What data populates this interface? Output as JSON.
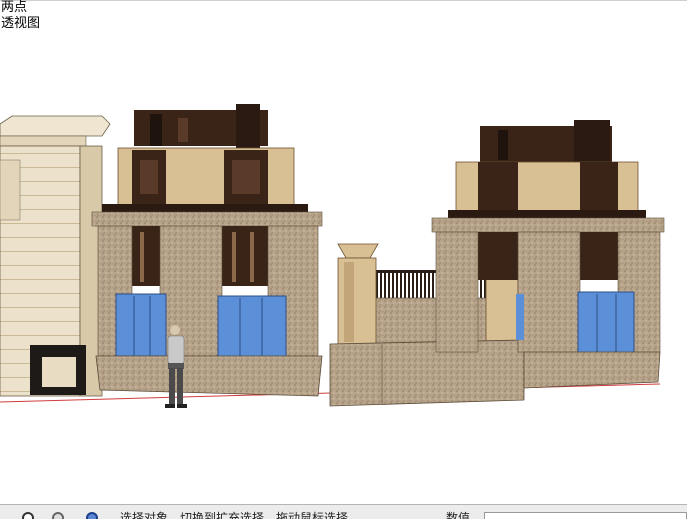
{
  "viewport": {
    "camera": {
      "line1": "两点",
      "line2": "透视图"
    }
  },
  "status": {
    "text": "选择对象。切换到扩充选择。拖动鼠标选择",
    "measure_label": "数值"
  },
  "colors": {
    "stone_light": "#e8dcc3",
    "granite": "#b29f86",
    "dark_wood": "#3a2418",
    "glass": "#5b8fd8",
    "tan_wall": "#d9bf94",
    "axis_red": "#d23b3b"
  }
}
